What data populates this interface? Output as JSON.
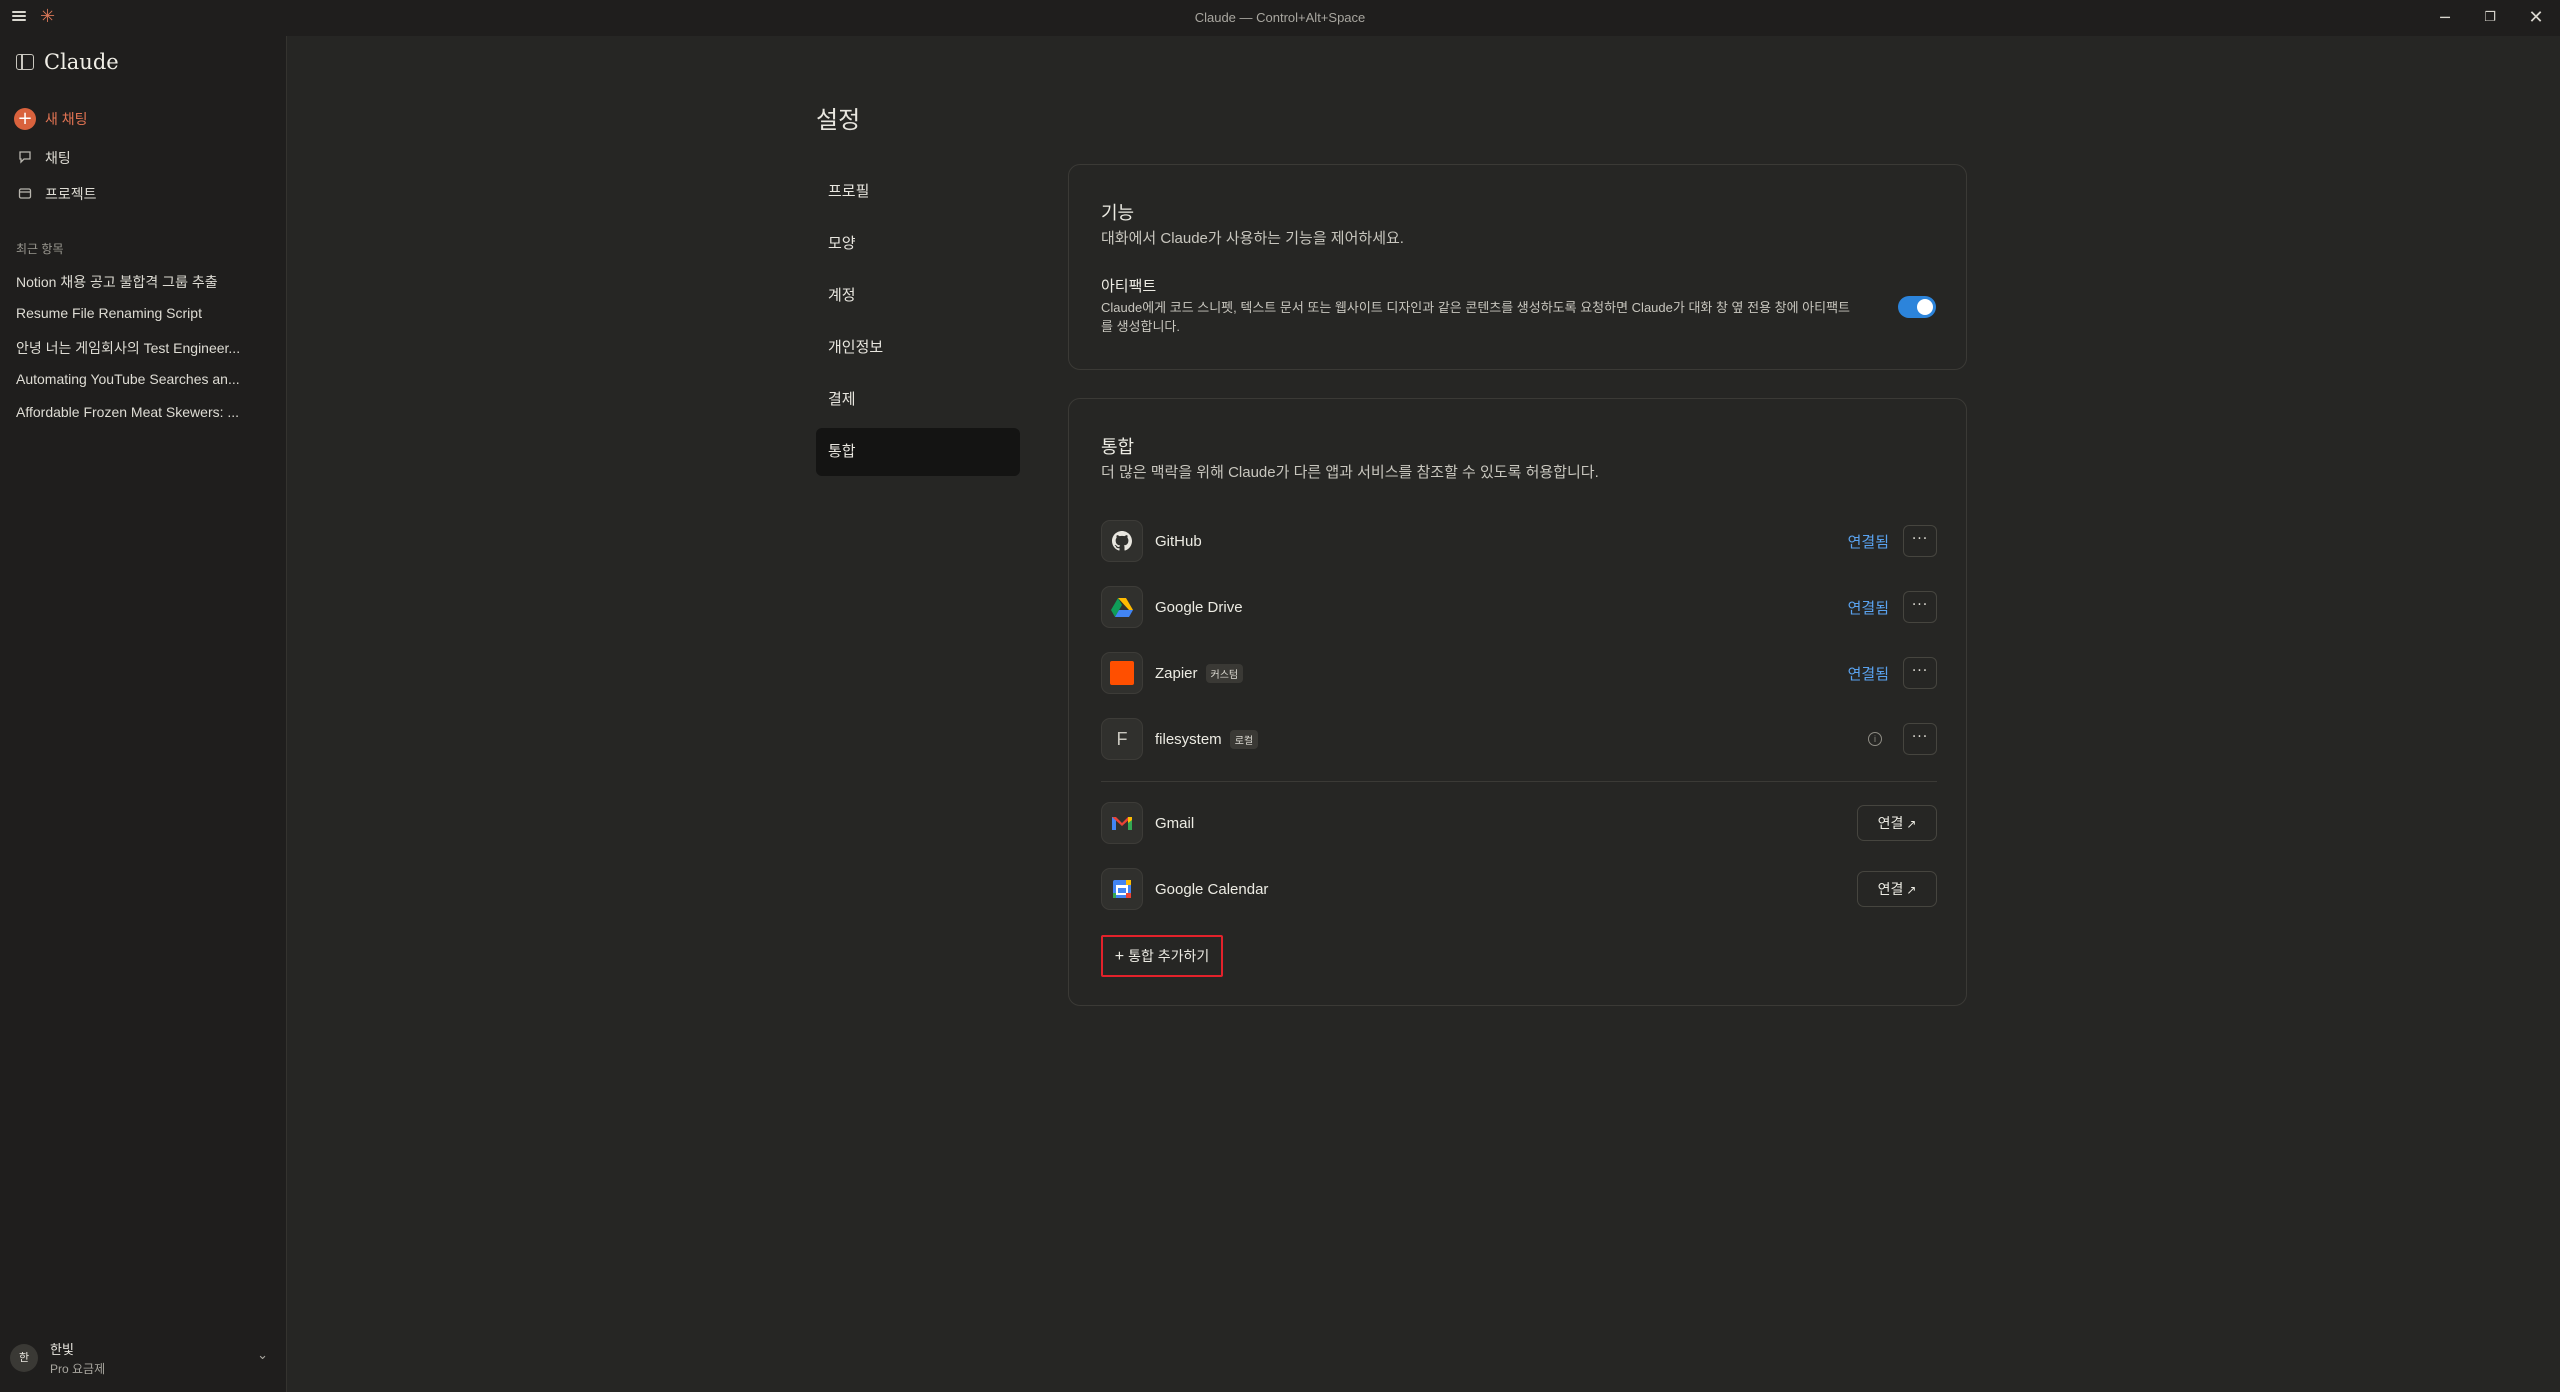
{
  "window": {
    "title": "Claude — Control+Alt+Space",
    "controls": {
      "minimize": "─",
      "maximize": "❐",
      "close": "✕"
    }
  },
  "sidebar": {
    "brand": "Claude",
    "new_chat": "새 채팅",
    "nav": [
      {
        "label": "채팅",
        "icon": "chat-bubble-icon"
      },
      {
        "label": "프로젝트",
        "icon": "folder-icon"
      }
    ],
    "recent_header": "최근 항목",
    "recent": [
      "Notion 채용 공고 불합격 그룹 추출",
      "Resume File Renaming Script",
      "안녕 너는 게임회사의 Test Engineer...",
      "Automating YouTube Searches an...",
      "Affordable Frozen Meat Skewers: ..."
    ],
    "user": {
      "avatar": "한",
      "name": "한빛",
      "plan": "Pro 요금제"
    }
  },
  "settings": {
    "title": "설정",
    "nav": [
      "프로필",
      "모양",
      "계정",
      "개인정보",
      "결제",
      "통합"
    ],
    "active_nav": "통합"
  },
  "features": {
    "title": "기능",
    "desc": "대화에서 Claude가 사용하는 기능을 제어하세요.",
    "artifacts_title": "아티팩트",
    "artifacts_desc": "Claude에게 코드 스니펫, 텍스트 문서 또는 웹사이트 디자인과 같은 콘텐츠를 생성하도록 요청하면 Claude가 대화 창 옆 전용 창에 아티팩트를 생성합니다.",
    "artifacts_enabled": true,
    "toggle_color": "#2c84db"
  },
  "integrations": {
    "title": "통합",
    "desc": "더 많은 맥락을 위해 Claude가 다른 앱과 서비스를 참조할 수 있도록 허용합니다.",
    "connected": [
      {
        "name": "GitHub",
        "icon": "github-icon",
        "status": "연결됨",
        "tag": ""
      },
      {
        "name": "Google Drive",
        "icon": "google-drive-icon",
        "status": "연결됨",
        "tag": ""
      },
      {
        "name": "Zapier",
        "icon": "zapier-icon",
        "status": "연결됨",
        "tag": "커스텀"
      },
      {
        "name": "filesystem",
        "icon": "filesystem-icon",
        "status": "",
        "tag": "로컬"
      }
    ],
    "available": [
      {
        "name": "Gmail",
        "icon": "gmail-icon",
        "action": "연결"
      },
      {
        "name": "Google Calendar",
        "icon": "google-calendar-icon",
        "action": "연결"
      }
    ],
    "more_label": "···",
    "info_label": "i",
    "add_button": "통합 추가하기",
    "status_color": "#5aa3f0",
    "highlight_color": "#e3222b"
  }
}
